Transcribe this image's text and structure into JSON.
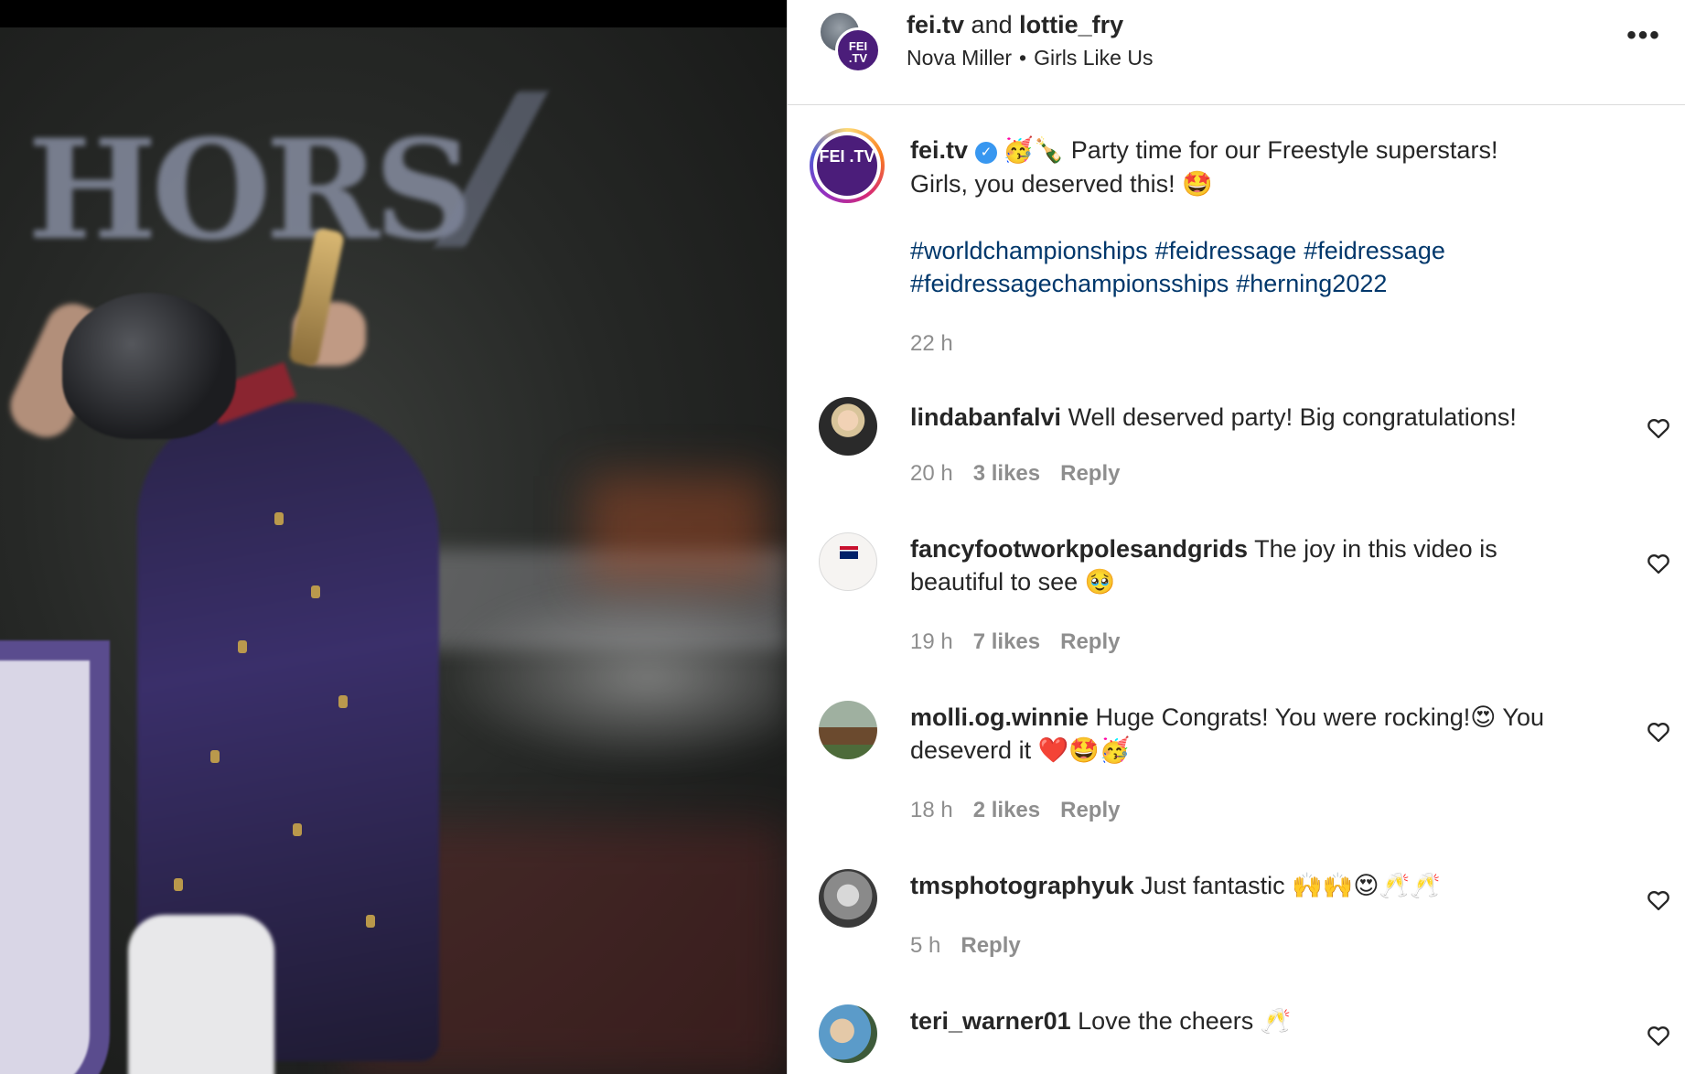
{
  "header": {
    "account_primary": "fei.tv",
    "connector": "and",
    "account_secondary": "lottie_fry",
    "audio_artist": "Nova Miller",
    "separator": "•",
    "audio_track": "Girls Like Us",
    "more_label": "•••",
    "avatar_text": "FEI .TV"
  },
  "post": {
    "username": "fei.tv",
    "verified_mark": "✓",
    "caption_emoji_1": "🥳🍾",
    "caption_line_1": "Party time for our Freestyle superstars!",
    "caption_line_2": "Girls, you deserved this!",
    "caption_emoji_2": "🤩",
    "hashtags": [
      "#worldchampionships",
      "#feidressage",
      "#feidressage",
      "#feidressagechampionsships",
      "#herning2022"
    ],
    "time": "22 h",
    "avatar_text": "FEI .TV"
  },
  "comments": [
    {
      "username": "lindabanfalvi",
      "text": "Well deserved party! Big congratulations!",
      "time": "20 h",
      "likes": "3 likes",
      "reply": "Reply"
    },
    {
      "username": "fancyfootworkpolesandgrids",
      "text": "The joy in this video is beautiful to see 🥹",
      "time": "19 h",
      "likes": "7 likes",
      "reply": "Reply"
    },
    {
      "username": "molli.og.winnie",
      "text": "Huge Congrats! You were rocking!😍 You deseverd it ❤️🤩🥳",
      "time": "18 h",
      "likes": "2 likes",
      "reply": "Reply"
    },
    {
      "username": "tmsphotographyuk",
      "text": "Just fantastic 🙌🙌😍🥂🥂",
      "time": "5 h",
      "likes": "",
      "reply": "Reply"
    },
    {
      "username": "teri_warner01",
      "text": "Love the cheers 🥂",
      "time": "",
      "likes": "",
      "reply": ""
    }
  ],
  "media": {
    "banner_text": "HORS"
  },
  "colors": {
    "hashtag": "#00376b",
    "meta_gray": "#8e8e8e",
    "verified_blue": "#3897f0",
    "fei_purple": "#4b1d7a",
    "divider": "#dbdbdb"
  }
}
